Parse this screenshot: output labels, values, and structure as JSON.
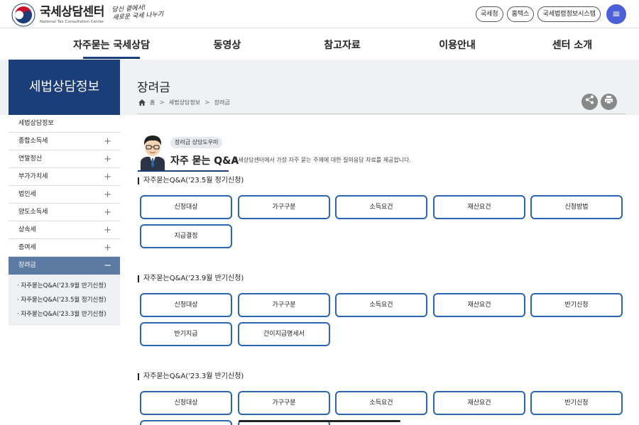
{
  "header": {
    "logo_title": "국세상담센터",
    "logo_subtitle": "National Tax Consultation Center",
    "slogan_line1": "당신 곁에서!",
    "slogan_line2": "새로운 국세 나누기",
    "links": [
      "국세청",
      "홈택스",
      "국세법령정보시스템"
    ],
    "menu_icon": "≡"
  },
  "gnb": [
    "자주묻는 국세상담",
    "동영상",
    "참고자료",
    "이용안내",
    "센터 소개"
  ],
  "sidebar": {
    "title": "세법상담정보",
    "items": [
      {
        "label": "세법상담정보",
        "plus": ""
      },
      {
        "label": "종합소득세",
        "plus": "+"
      },
      {
        "label": "연말정산",
        "plus": "+"
      },
      {
        "label": "부가가치세",
        "plus": "+"
      },
      {
        "label": "법인세",
        "plus": "+"
      },
      {
        "label": "양도소득세",
        "plus": "+"
      },
      {
        "label": "상속세",
        "plus": "+"
      },
      {
        "label": "증여세",
        "plus": "+"
      },
      {
        "label": "장려금",
        "plus": "−"
      }
    ],
    "sub_items": [
      "자주묻는Q&A('23.9월 반기신청)",
      "자주묻는Q&A('23.5월 정기신청)",
      "자주묻는Q&A('23.3월 반기신청)"
    ]
  },
  "page": {
    "title": "장려금",
    "breadcrumb": [
      "홈",
      "세법상담정보",
      "장려금"
    ],
    "share_icon": "share-icon",
    "print_icon": "print-icon"
  },
  "qa_banner": {
    "tag": "장려금 상담도우미",
    "title": "자주 묻는 Q&A",
    "description": "국세상담센터에서 가장 자주 묻는 주제에 대한 질의응답 자료를 제공합니다."
  },
  "sections": [
    {
      "title": "자주묻는Q&A('23.5월 정기신청)",
      "buttons": [
        "신청대상",
        "가구구분",
        "소득요건",
        "재산요건",
        "신청방법",
        "지급결정"
      ]
    },
    {
      "title": "자주묻는Q&A('23.9월 반기신청)",
      "buttons": [
        "신청대상",
        "가구구분",
        "소득요건",
        "재산요건",
        "반기신청",
        "반기지급",
        "간이지급명세서"
      ]
    },
    {
      "title": "자주묻는Q&A('23.3월 반기신청)",
      "buttons": [
        "신청대상",
        "가구구분",
        "소득요건",
        "재산요건",
        "반기신청"
      ]
    }
  ]
}
